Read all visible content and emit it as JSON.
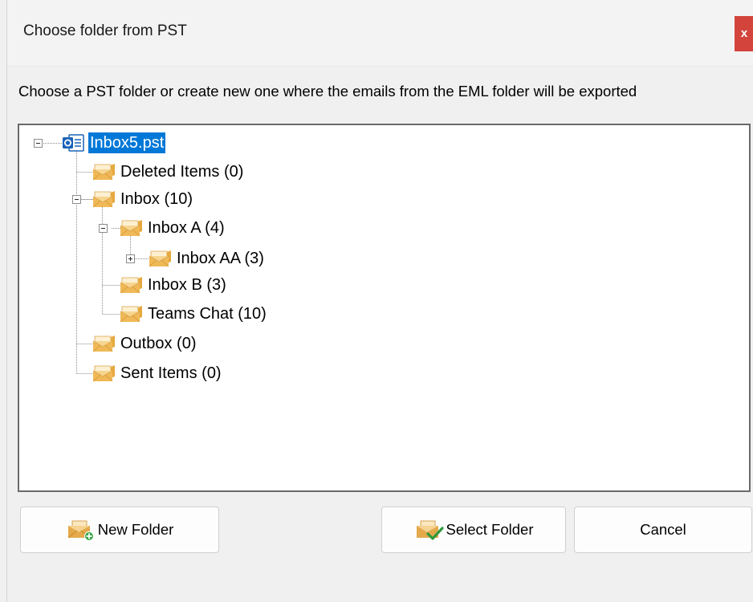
{
  "window": {
    "title": "Choose folder from PST",
    "close_label": "x"
  },
  "instruction": "Choose a PST folder or create new one where the emails from the EML folder will be exported",
  "tree": {
    "root": {
      "label": "Inbox5.pst",
      "icon": "outlook-pst-icon",
      "selected": true,
      "expanded": true
    },
    "nodes": [
      {
        "label": "Deleted Items (0)",
        "icon": "folder-envelope-icon"
      },
      {
        "label": "Inbox (10)",
        "icon": "folder-envelope-icon",
        "expanded": true
      },
      {
        "label": "Inbox A (4)",
        "icon": "folder-envelope-icon",
        "expanded": true
      },
      {
        "label": "Inbox AA (3)",
        "icon": "folder-envelope-icon",
        "expanded": false
      },
      {
        "label": "Inbox B (3)",
        "icon": "folder-envelope-icon"
      },
      {
        "label": "Teams Chat (10)",
        "icon": "folder-envelope-icon"
      },
      {
        "label": "Outbox (0)",
        "icon": "folder-envelope-icon"
      },
      {
        "label": "Sent Items (0)",
        "icon": "folder-envelope-icon"
      }
    ]
  },
  "buttons": {
    "new_folder": "New Folder",
    "select_folder": "Select Folder",
    "cancel": "Cancel"
  },
  "colors": {
    "selection": "#0078d7",
    "close": "#d2443c",
    "folder": "#f2c77a"
  }
}
